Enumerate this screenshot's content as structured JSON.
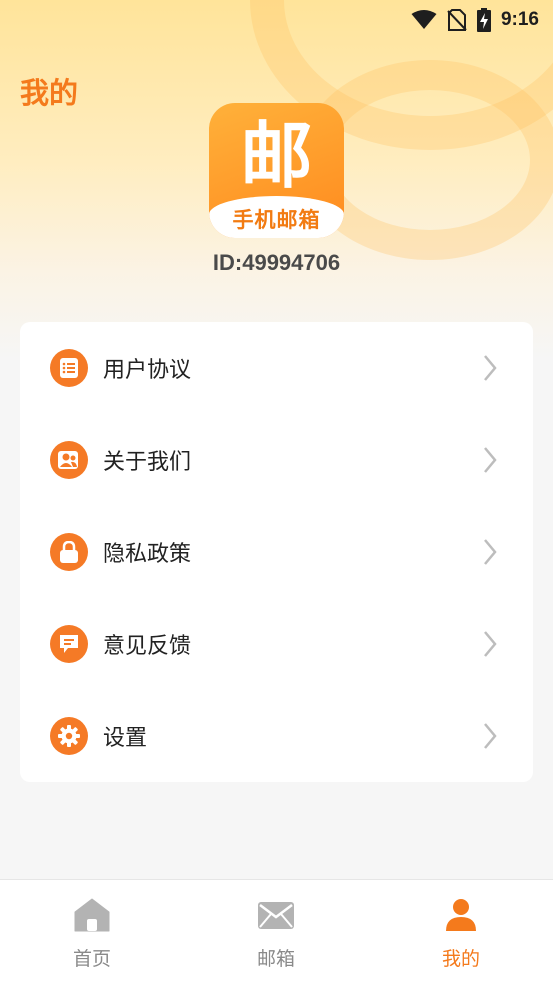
{
  "status_bar": {
    "time": "9:16"
  },
  "header": {
    "title": "我的"
  },
  "app": {
    "logo_char": "邮",
    "logo_text": "手机邮箱",
    "user_id": "ID:49994706"
  },
  "menu": {
    "items": [
      {
        "label": "用户协议",
        "icon": "document-list-icon"
      },
      {
        "label": "关于我们",
        "icon": "users-icon"
      },
      {
        "label": "隐私政策",
        "icon": "lock-icon"
      },
      {
        "label": "意见反馈",
        "icon": "chat-bubble-icon"
      },
      {
        "label": "设置",
        "icon": "gear-icon"
      }
    ]
  },
  "tab_bar": {
    "tabs": [
      {
        "label": "首页",
        "icon": "home-icon"
      },
      {
        "label": "邮箱",
        "icon": "envelope-icon"
      },
      {
        "label": "我的",
        "icon": "person-icon",
        "active": true
      }
    ]
  },
  "colors": {
    "accent": "#f47a1c",
    "icon_bg": "#f57a26",
    "inactive_tab": "#8a8a8a"
  }
}
